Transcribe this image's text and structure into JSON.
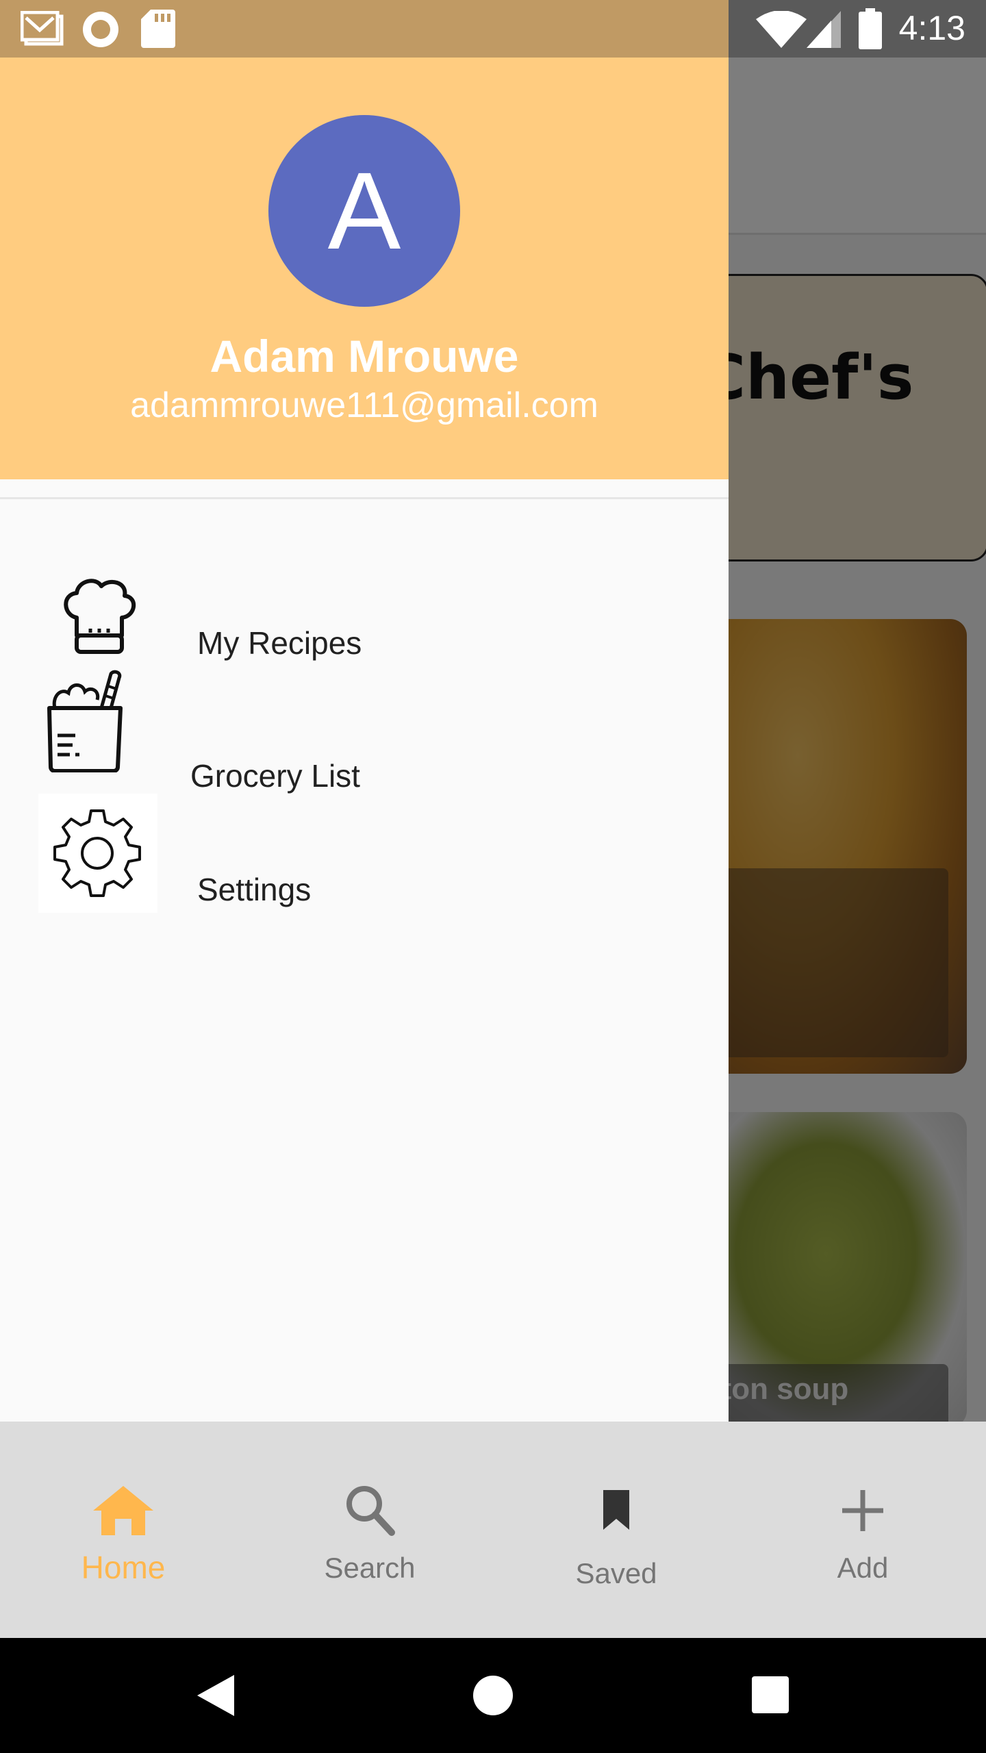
{
  "status_bar": {
    "time": "4:13",
    "icons": [
      "gmail-icon",
      "record-icon",
      "sd-card-icon",
      "wifi-icon",
      "signal-icon",
      "battery-icon"
    ]
  },
  "background": {
    "card_title": "Chef's",
    "card2_title": "stilton soup"
  },
  "drawer": {
    "avatar_letter": "A",
    "user_name": "Adam Mrouwe",
    "user_email": "adammrouwe111@gmail.com",
    "items": [
      {
        "label": "My Recipes",
        "icon": "chef-hat-icon"
      },
      {
        "label": "Grocery List",
        "icon": "grocery-bag-icon"
      },
      {
        "label": "Settings",
        "icon": "gear-icon"
      }
    ]
  },
  "bottom_nav": {
    "items": [
      {
        "label": "Home",
        "icon": "home-icon",
        "active": true
      },
      {
        "label": "Search",
        "icon": "search-icon",
        "active": false
      },
      {
        "label": "Saved",
        "icon": "bookmark-icon",
        "active": false
      },
      {
        "label": "Add",
        "icon": "plus-icon",
        "active": false
      }
    ]
  },
  "colors": {
    "header": "#ffcc80",
    "avatar": "#5c6bc0",
    "active_nav": "#ffb74d",
    "status_bar": "#c09a64"
  }
}
